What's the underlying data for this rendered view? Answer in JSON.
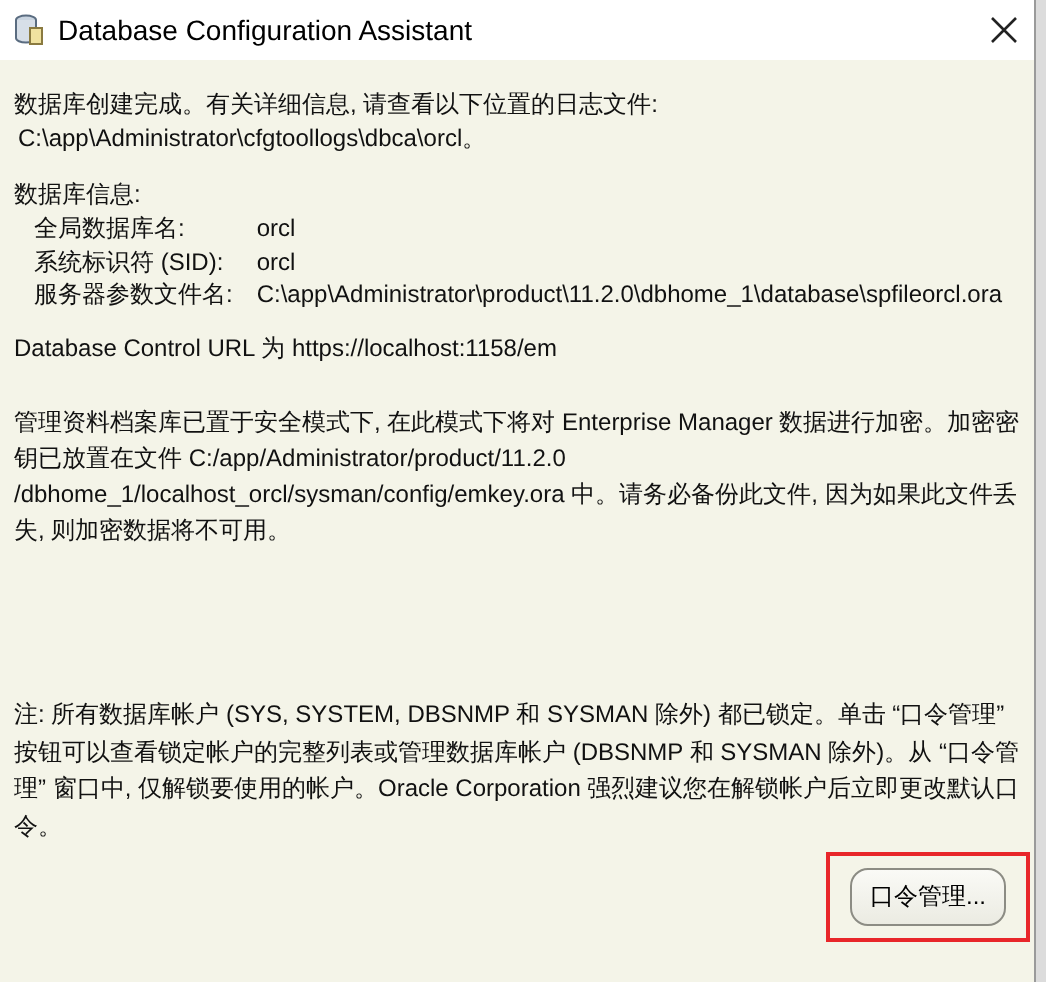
{
  "window": {
    "title": "Database Configuration Assistant"
  },
  "log_info": {
    "text": "数据库创建完成。有关详细信息, 请查看以下位置的日志文件:",
    "path": "C:\\app\\Administrator\\cfgtoollogs\\dbca\\orcl。"
  },
  "database_info": {
    "heading": "数据库信息:",
    "rows": [
      {
        "label": "全局数据库名:",
        "value": "orcl"
      },
      {
        "label": "系统标识符 (SID):",
        "value": "orcl"
      },
      {
        "label": "服务器参数文件名:",
        "value": "C:\\app\\Administrator\\product\\11.2.0\\dbhome_1\\database\\spfileorcl.ora"
      }
    ]
  },
  "url_text": "Database Control URL 为 https://localhost:1158/em",
  "encryption_note": "管理资料档案库已置于安全模式下, 在此模式下将对 Enterprise Manager 数据进行加密。加密密钥已放置在文件 C:/app/Administrator/product/11.2.0 /dbhome_1/localhost_orcl/sysman/config/emkey.ora 中。请务必备份此文件, 因为如果此文件丢失, 则加密数据将不可用。",
  "accounts_note": "注: 所有数据库帐户 (SYS, SYSTEM, DBSNMP 和 SYSMAN 除外) 都已锁定。单击 “口令管理” 按钮可以查看锁定帐户的完整列表或管理数据库帐户 (DBSNMP 和 SYSMAN 除外)。从 “口令管理” 窗口中, 仅解锁要使用的帐户。Oracle Corporation 强烈建议您在解锁帐户后立即更改默认口令。",
  "buttons": [
    {
      "label": "口令管理...",
      "highlighted": true
    }
  ]
}
